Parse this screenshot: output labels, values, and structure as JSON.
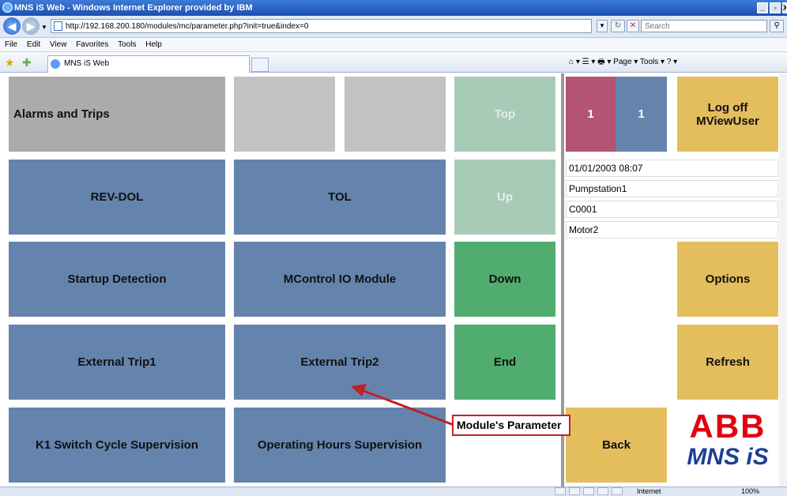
{
  "window": {
    "title": "MNS iS Web - Windows Internet Explorer provided by IBM",
    "minimize": "_",
    "restore": "ð",
    "close": "X"
  },
  "address": {
    "url": "http://192.168.200.180/modules/mc/parameter.php?init=true&index=0",
    "search_placeholder": "Search"
  },
  "menu": [
    "File",
    "Edit",
    "View",
    "Favorites",
    "Tools",
    "Help"
  ],
  "tab": {
    "label": "MNS iS Web"
  },
  "commandbar": {
    "text": "⌂ ▾  ☰ ▾  🖶 ▾  Page ▾  Tools ▾  ? ▾"
  },
  "grid": {
    "alarms": "Alarms and Trips",
    "top": "Top",
    "rev_dol": "REV-DOL",
    "tol": "TOL",
    "up": "Up",
    "startup": "Startup Detection",
    "mcontrol_io": "MControl IO Module",
    "down": "Down",
    "ext_trip1": "External Trip1",
    "ext_trip2": "External Trip2",
    "end": "End",
    "k1_switch": "K1 Switch Cycle Supervision",
    "operating_hours": "Operating Hours Supervision"
  },
  "right": {
    "counter_alarms": "1",
    "counter_trips": "1",
    "logoff": "Log off MViewUser",
    "datetime": "01/01/2003 08:07",
    "station": "Pumpstation1",
    "code": "C0001",
    "motor": "Motor2",
    "options": "Options",
    "refresh": "Refresh",
    "back": "Back",
    "logo_abb": "ABB",
    "logo_mns": "MNS iS"
  },
  "statusbar": {
    "zone": "Internet",
    "zoom": "100%"
  },
  "annotation": {
    "label": "Module's Parameter"
  },
  "colors": {
    "tile_blue": "#6584ad",
    "tile_grey": "#ababab",
    "nav_disabled": "#a8cbb8",
    "nav_enabled": "#50ad6f",
    "action_yellow": "#e4be5d",
    "alarm_red": "#b35473",
    "abb_red": "#e2000f",
    "mns_blue": "#1c3f94",
    "callout_red": "#c0212a"
  }
}
